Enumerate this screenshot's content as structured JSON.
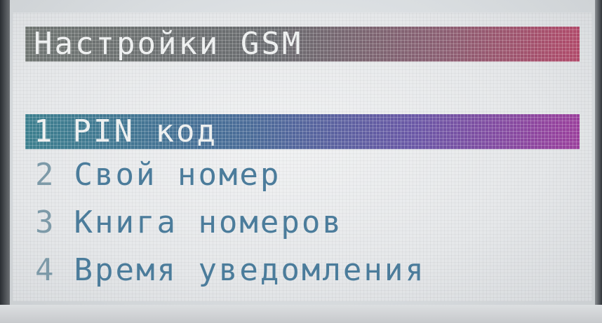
{
  "screen": {
    "title": "Настройки GSM",
    "menu": [
      {
        "number": "1",
        "label": "PIN код"
      },
      {
        "number": "2",
        "label": "Свой номер"
      },
      {
        "number": "3",
        "label": "Книга номеров"
      },
      {
        "number": "4",
        "label": "Время уведомления"
      }
    ],
    "selected_index": 0
  },
  "colors": {
    "lcd_background": "#e6e8ea",
    "menu_text": "#4b7c9b",
    "title_bar_start": "#6f7572",
    "title_bar_end": "#b04a6a",
    "selection_bar_start": "#3c7f8e",
    "selection_bar_end": "#9a3f9c",
    "highlight_text": "#eef0f0"
  }
}
